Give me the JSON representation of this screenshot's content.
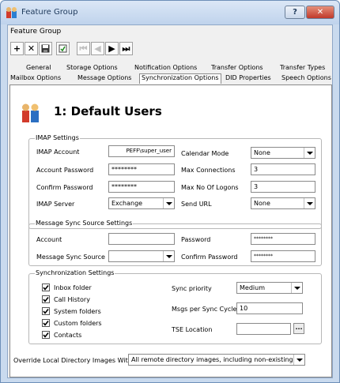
{
  "window": {
    "title": "Feature Group",
    "help_label": "?",
    "close_label": "✕"
  },
  "form_title": "Feature Group",
  "toolbar": {
    "icons": [
      "add-icon",
      "delete-icon",
      "save-icon",
      "refresh-icon",
      "first-record-icon",
      "previous-record-icon",
      "next-record-icon",
      "last-record-icon"
    ]
  },
  "tabs": {
    "row1": [
      "General",
      "Storage Options",
      "Notification Options",
      "Transfer Options",
      "Transfer Types"
    ],
    "row2": [
      "Mailbox Options",
      "Message Options",
      "Synchronization Options",
      "DID Properties",
      "Speech Options"
    ],
    "selected": "Synchronization Options"
  },
  "user": {
    "title": "1: Default Users"
  },
  "imap": {
    "group_label": "IMAP Settings",
    "account_label": "IMAP Account",
    "account_value": "PEFF\\super_user",
    "password_label": "Account Password",
    "password_value": "********",
    "confirm_label": "Confirm Password",
    "confirm_value": "********",
    "server_label": "IMAP Server",
    "server_value": "Exchange",
    "calendar_label": "Calendar Mode",
    "calendar_value": "None",
    "maxconn_label": "Max Connections",
    "maxconn_value": "3",
    "maxlogons_label": "Max No Of Logons",
    "maxlogons_value": "3",
    "sendurl_label": "Send URL",
    "sendurl_value": "None"
  },
  "msgsync": {
    "group_label": "Message Sync Source Settings",
    "account_label": "Account",
    "account_value": "",
    "source_label": "Message Sync Source",
    "source_value": "",
    "password_label": "Password",
    "password_value": "********",
    "confirm_label": "Confirm Password",
    "confirm_value": "********"
  },
  "sync": {
    "group_label": "Synchronization Settings",
    "checks": [
      {
        "label": "Inbox folder",
        "checked": true
      },
      {
        "label": "Call History",
        "checked": true
      },
      {
        "label": "System folders",
        "checked": true
      },
      {
        "label": "Custom folders",
        "checked": true
      },
      {
        "label": "Contacts",
        "checked": true
      }
    ],
    "priority_label": "Sync priority",
    "priority_value": "Medium",
    "msgs_label": "Msgs per Sync Cycle",
    "msgs_value": "10",
    "tse_label": "TSE Location",
    "tse_value": "",
    "browse_label": "..."
  },
  "override": {
    "label": "Override Local Directory Images With",
    "value": "All remote directory images, including non-existing"
  }
}
